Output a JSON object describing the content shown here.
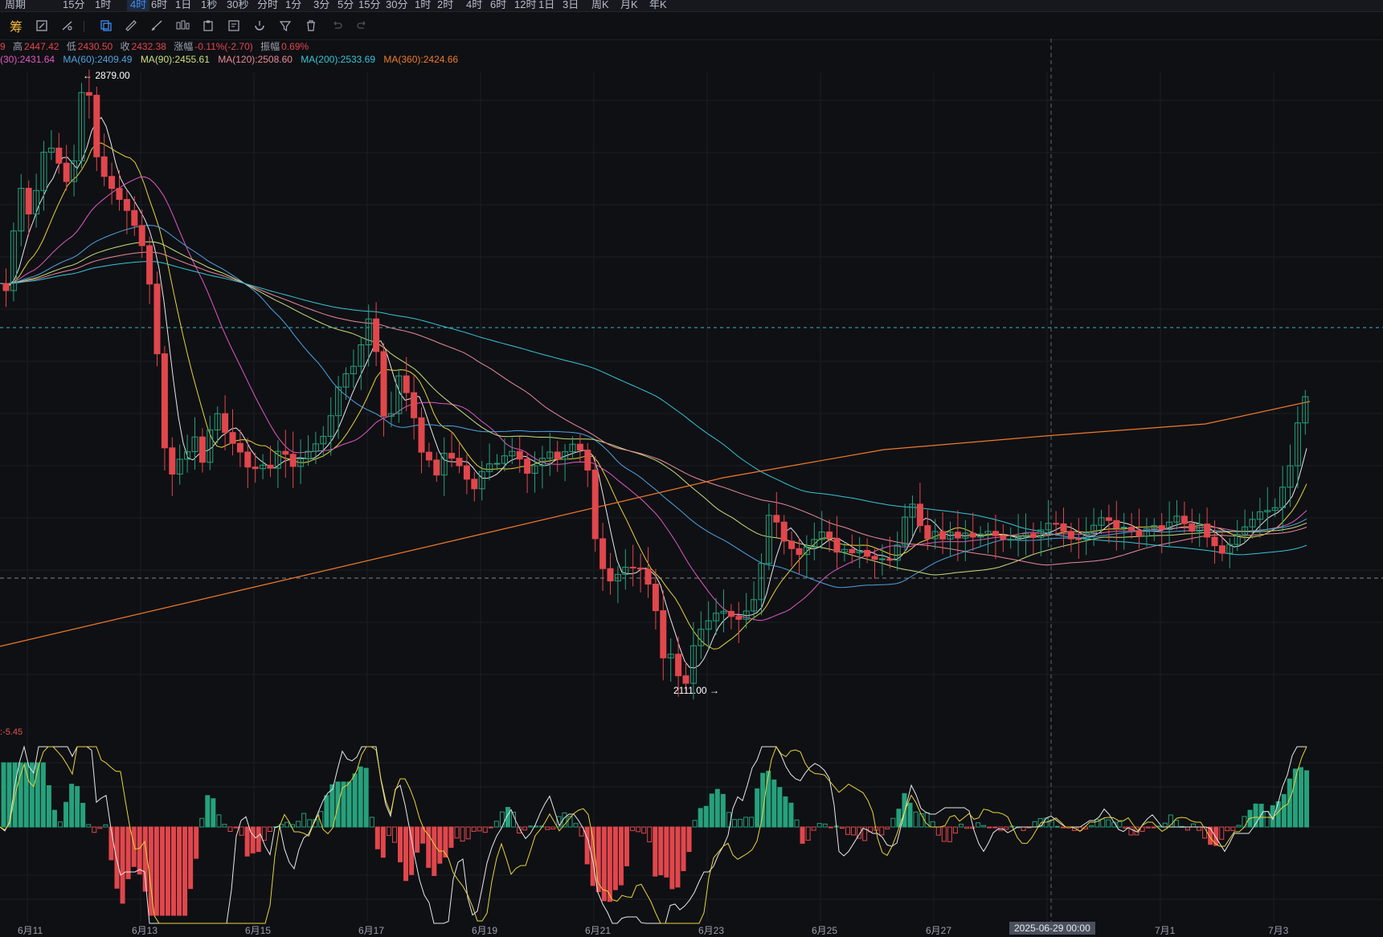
{
  "timeframe_tabs": [
    "周期",
    "15分",
    "1时",
    "4时",
    "6时",
    "1日",
    "1秒",
    "30秒",
    "分时",
    "1分",
    "3分",
    "5分",
    "15分",
    "30分",
    "1时",
    "2时",
    "4时",
    "6时",
    "12时",
    "1日",
    "3日",
    "周K",
    "月K",
    "年K"
  ],
  "toolbar": {
    "chou_label": "筹"
  },
  "info": {
    "open_partial": "9",
    "high_label": "高",
    "high_value": "2447.42",
    "low_label": "低",
    "low_value": "2430.50",
    "close_label": "收",
    "close_value": "2432.38",
    "change_label": "涨幅",
    "change_value": "-0.11%(-2.70)",
    "amp_label": "振幅",
    "amp_value": "0.69%"
  },
  "ma_legend": [
    {
      "text": "(30):2431.64",
      "color": "#e05ac0"
    },
    {
      "text": "MA(60):2409.49",
      "color": "#4fa3e0"
    },
    {
      "text": "MA(90):2455.61",
      "color": "#c8e07a"
    },
    {
      "text": "MA(120):2508.60",
      "color": "#e88a9a"
    },
    {
      "text": "MA(200):2533.69",
      "color": "#35c6d8"
    },
    {
      "text": "MA(360):2424.66",
      "color": "#f07a2a"
    }
  ],
  "macd_label": ":-5.45",
  "colors": {
    "up": "#26a17b",
    "down": "#e0474c",
    "background": "#0f1014"
  },
  "chart_data": {
    "type": "candlestick",
    "price_range": [
      2111,
      2879
    ],
    "high_marker": "2879.00",
    "low_marker": "2111.00",
    "x_tick_labels": [
      "6月11",
      "6月13",
      "6月15",
      "6月17",
      "6月19",
      "6月21",
      "6月23",
      "6月25",
      "6月27",
      "2025-06-29 00:00",
      "7月1",
      "7月3"
    ],
    "crosshair_label": "2025-06-29 00:00"
  }
}
